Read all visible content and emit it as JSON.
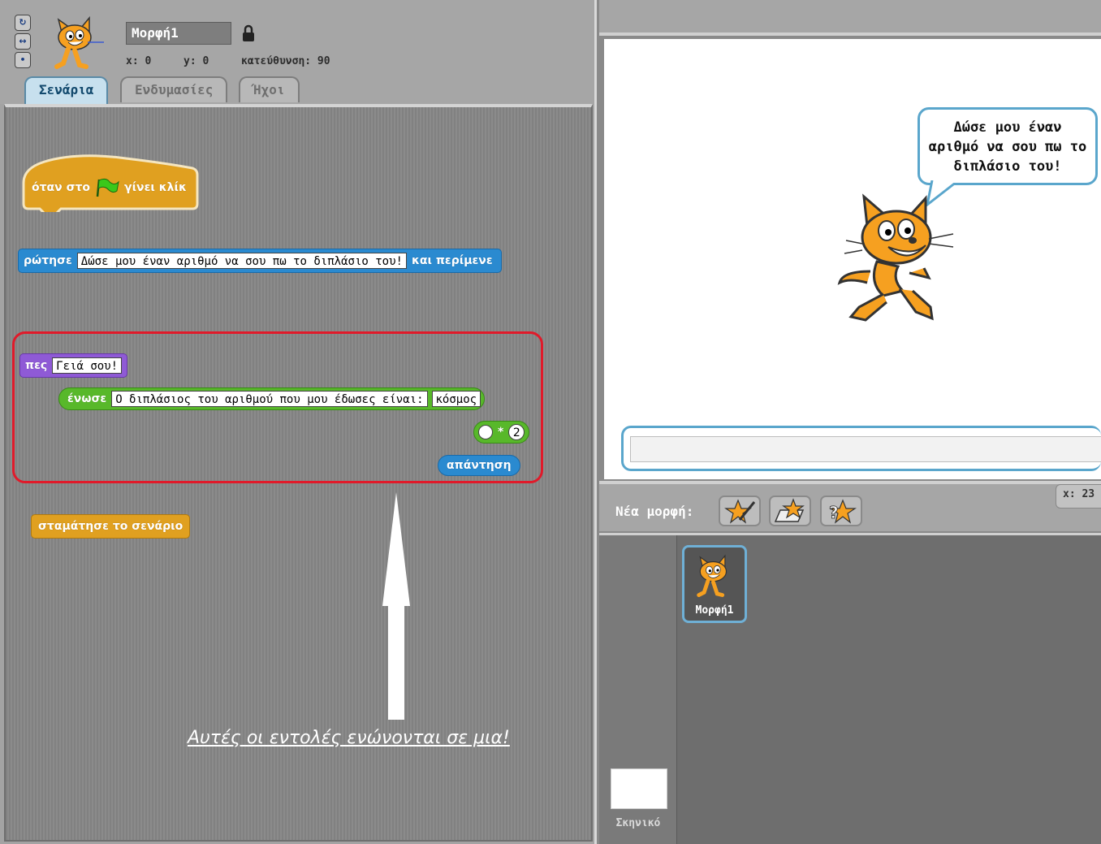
{
  "sprite": {
    "name": "Μορφή1",
    "x_label": "x: 0",
    "y_label": "y: 0",
    "direction_label": "κατεύθυνση: 90"
  },
  "tabs": [
    "Σενάρια",
    "Ενδυμασίες",
    "Ήχοι"
  ],
  "blocks": {
    "hat_prefix": "όταν στο",
    "hat_suffix": "γίνει κλίκ",
    "ask_label": "ρώτησε",
    "ask_text": "Δώσε μου έναν αριθμό να σου πω το διπλάσιο του!",
    "ask_suffix": "και περίμενε",
    "say_label": "πες",
    "say_text": "Γειά σου!",
    "join_label": "ένωσε",
    "join_text1": "Ο διπλάσιος του αριθμού που μου έδωσες είναι:",
    "join_text2": "κόσμος",
    "mult_op": "*",
    "mult_value": "2",
    "answer_label": "απάντηση",
    "stop_label": "σταμάτησε το σενάριο"
  },
  "annotation": "Αυτές οι εντολές ενώνονται σε μια!",
  "stage": {
    "speech": "Δώσε μου έναν αριθμό να σου πω το διπλάσιο του!"
  },
  "sprites_panel": {
    "new_sprite_label": "Νέα μορφή:",
    "xy_readout": "x: 23",
    "stage_label": "Σκηνικό",
    "sprite_tile_label": "Μορφή1"
  },
  "colors": {
    "control": "#e0a020",
    "sensing": "#2a8ad0",
    "looks": "#8f5ad6",
    "operators": "#58b82a",
    "highlight": "#e01a2a"
  }
}
